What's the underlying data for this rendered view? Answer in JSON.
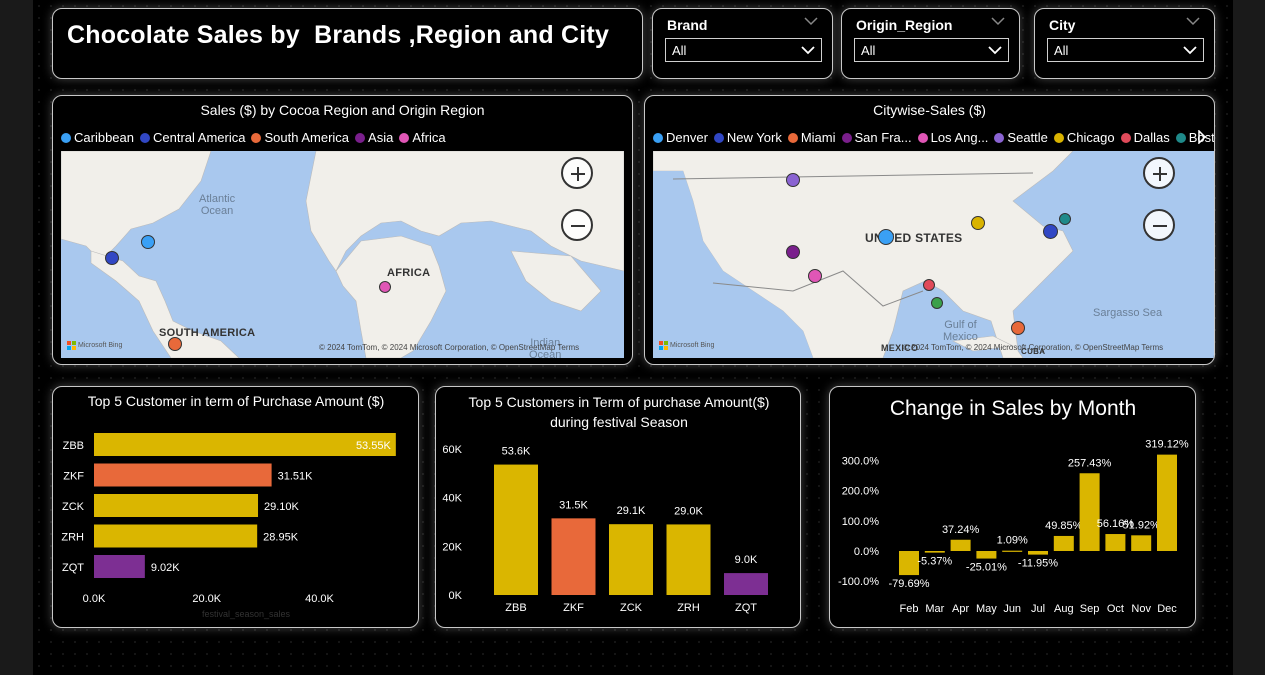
{
  "header": {
    "title": "Chocolate Sales by  Brands ,Region and City"
  },
  "slicers": [
    {
      "name": "brand",
      "label": "Brand",
      "value": "All"
    },
    {
      "name": "origin-region",
      "label": "Origin_Region",
      "value": "All"
    },
    {
      "name": "city",
      "label": "City",
      "value": "All"
    }
  ],
  "region_map": {
    "title": "Sales ($) by Cocoa Region and Origin Region",
    "legend": [
      {
        "label": "Caribbean",
        "color": "#3aa0f5"
      },
      {
        "label": "Central America",
        "color": "#3147c4"
      },
      {
        "label": "South America",
        "color": "#e8693a"
      },
      {
        "label": "Asia",
        "color": "#7a1f8c"
      },
      {
        "label": "Africa",
        "color": "#e056b6"
      }
    ],
    "labels": {
      "atlantic": "Atlantic\nOcean",
      "africa": "AFRICA",
      "south_america": "SOUTH AMERICA",
      "indian": "Indian\nOcean"
    },
    "attribution": "Microsoft Bing",
    "copyright": "© 2024 TomTom, © 2024 Microsoft Corporation, © OpenStreetMap  Terms"
  },
  "city_map": {
    "title": "Citywise-Sales ($)",
    "legend": [
      {
        "label": "Denver",
        "color": "#3aa0f5"
      },
      {
        "label": "New York",
        "color": "#3147c4"
      },
      {
        "label": "Miami",
        "color": "#e8693a"
      },
      {
        "label": "San Fra...",
        "color": "#7a1f8c"
      },
      {
        "label": "Los Ang...",
        "color": "#e056b6"
      },
      {
        "label": "Seattle",
        "color": "#8a63d2"
      },
      {
        "label": "Chicago",
        "color": "#d9b300"
      },
      {
        "label": "Dallas",
        "color": "#e04a5a"
      },
      {
        "label": "Boston",
        "color": "#1f8a8a"
      }
    ],
    "labels": {
      "usa": "UNITED STATES",
      "gulf": "Gulf of\nMexico",
      "sargasso": "Sargasso Sea",
      "mexico": "MEXICO",
      "cuba": "CUBA"
    },
    "attribution": "Microsoft Bing",
    "copyright": "© 2024 TomTom, © 2024 Microsoft Corporation, © OpenStreetMap  Terms"
  },
  "zoom": {
    "in": "+",
    "out": "−"
  },
  "chart_data": [
    {
      "type": "bar",
      "orientation": "horizontal",
      "title": "Top 5 Customer in term of Purchase Amount ($)",
      "categories": [
        "ZBB",
        "ZKF",
        "ZCK",
        "ZRH",
        "ZQT"
      ],
      "values": [
        53.55,
        31.51,
        29.1,
        28.95,
        9.02
      ],
      "data_labels": [
        "53.55K",
        "31.51K",
        "29.10K",
        "28.95K",
        "9.02K"
      ],
      "colors": [
        "#dab600",
        "#e8693a",
        "#dab600",
        "#dab600",
        "#7d2f93"
      ],
      "x_ticks": [
        "0.0K",
        "20.0K",
        "40.0K"
      ],
      "xlabel": "festival_season_sales",
      "xlim": [
        0,
        55
      ]
    },
    {
      "type": "bar",
      "title": "Top 5 Customers in Term of purchase Amount($)\nduring festival Season",
      "categories": [
        "ZBB",
        "ZKF",
        "ZCK",
        "ZRH",
        "ZQT"
      ],
      "values": [
        53.6,
        31.5,
        29.1,
        29.0,
        9.0
      ],
      "data_labels": [
        "53.6K",
        "31.5K",
        "29.1K",
        "29.0K",
        "9.0K"
      ],
      "colors": [
        "#dab600",
        "#e8693a",
        "#dab600",
        "#dab600",
        "#7d2f93"
      ],
      "y_ticks": [
        "60K",
        "40K",
        "20K",
        "0K"
      ],
      "ylim": [
        0,
        60
      ]
    },
    {
      "type": "bar",
      "title": "Change in Sales by Month",
      "categories": [
        "Feb",
        "Mar",
        "Apr",
        "May",
        "Jun",
        "Jul",
        "Aug",
        "Sep",
        "Oct",
        "Nov",
        "Dec"
      ],
      "values": [
        -79.69,
        -5.37,
        37.24,
        -25.01,
        1.09,
        -11.95,
        49.85,
        257.43,
        56.16,
        51.92,
        319.12
      ],
      "data_labels": [
        "-79.69%",
        "-5.37%",
        "37.24%",
        "-25.01%",
        "1.09%",
        "-11.95%",
        "49.85%",
        "257.43%",
        "56.16%",
        "51.92%",
        "319.12%"
      ],
      "color": "#dab600",
      "y_ticks": [
        "300.0%",
        "200.0%",
        "100.0%",
        "0.0%",
        "-100.0%"
      ],
      "ylim": [
        -100,
        330
      ]
    }
  ]
}
